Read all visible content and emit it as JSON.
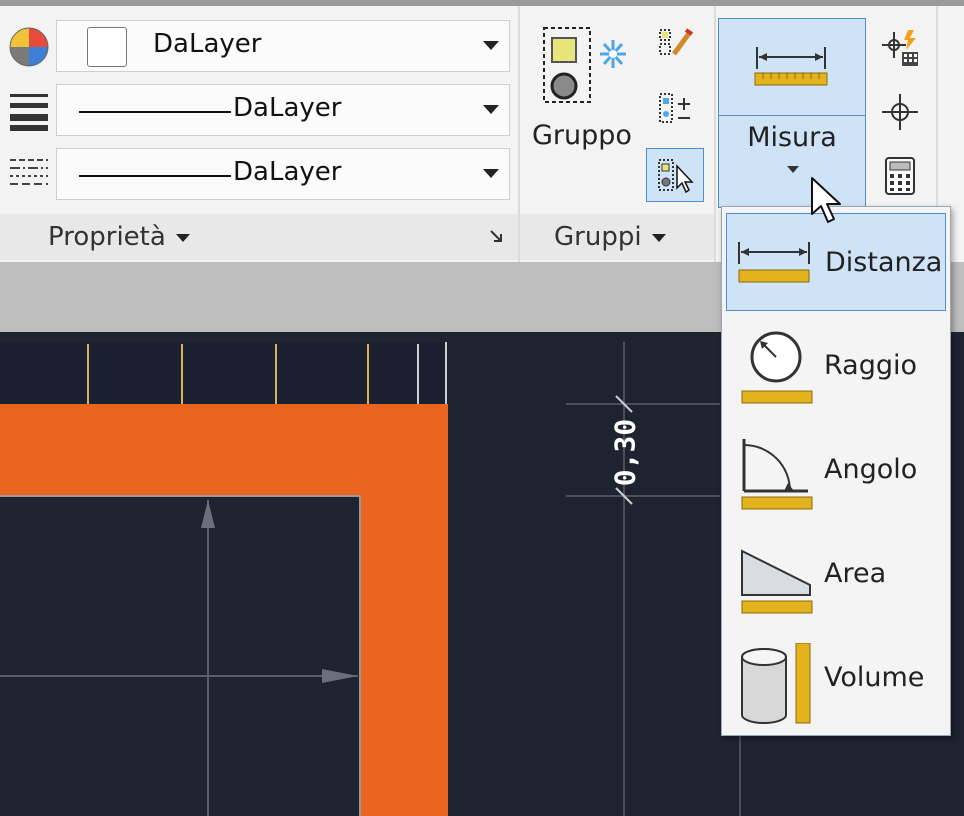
{
  "properties": {
    "color_value": "DaLayer",
    "lineweight_value": "DaLayer",
    "linetype_value": "DaLayer",
    "panel_label": "Proprietà"
  },
  "groups": {
    "group_label": "Gruppo",
    "panel_label": "Gruppi"
  },
  "utilities": {
    "measure_label": "Misura"
  },
  "measure_menu": {
    "items": [
      {
        "label": "Distanza",
        "icon": "distance-icon",
        "selected": true
      },
      {
        "label": "Raggio",
        "icon": "radius-icon",
        "selected": false
      },
      {
        "label": "Angolo",
        "icon": "angle-icon",
        "selected": false
      },
      {
        "label": "Area",
        "icon": "area-icon",
        "selected": false
      },
      {
        "label": "Volume",
        "icon": "volume-icon",
        "selected": false
      }
    ]
  },
  "drawing": {
    "dimension_text": "0,30"
  },
  "colors": {
    "ribbon_bg": "#f3f3f3",
    "highlight": "#cfe3f6",
    "highlight_border": "#4f8fd1",
    "canvas_bg": "#1e2330",
    "wall_orange": "#e8641f",
    "ruler_yellow": "#e3b21c"
  }
}
